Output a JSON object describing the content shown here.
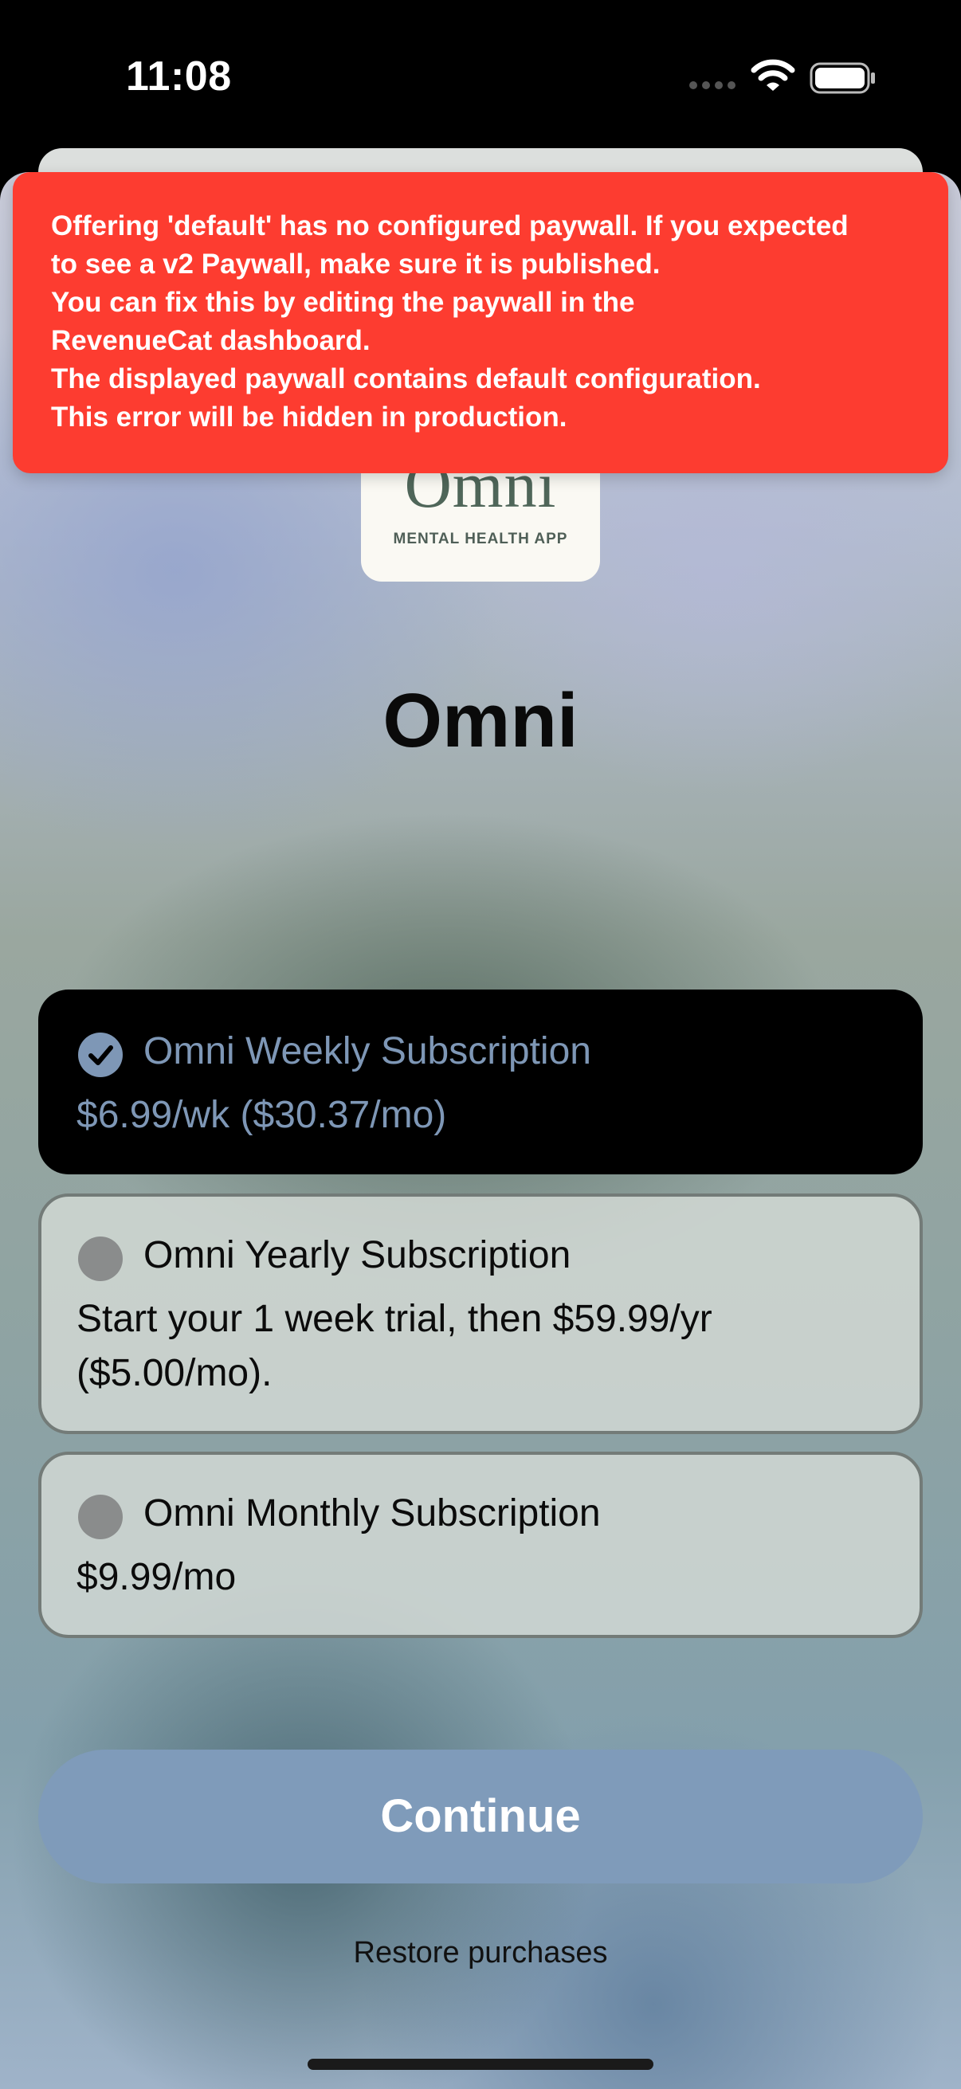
{
  "status_bar": {
    "time": "11:08",
    "icons": [
      "cellular-signal-icon",
      "wifi-icon",
      "battery-icon"
    ]
  },
  "error_banner": {
    "color": "#fd3c30",
    "lines": [
      "Offering 'default' has no configured paywall. If you expected",
      "to see a v2 Paywall, make sure it is published.",
      "You can fix this by editing the paywall in the",
      "RevenueCat dashboard.",
      "The displayed paywall contains default configuration.",
      "This error will be hidden in production."
    ]
  },
  "app_logo": {
    "wordmark": "Omni",
    "tagline": "MENTAL HEALTH APP"
  },
  "title": "Omni",
  "packages": [
    {
      "name": "Omni Weekly Subscription",
      "description": "$6.99/wk ($30.37/mo)",
      "selected": true
    },
    {
      "name": "Omni Yearly Subscription",
      "description": "Start your 1 week trial, then $59.99/yr ($5.00/mo).",
      "selected": false
    },
    {
      "name": "Omni Monthly Subscription",
      "description": "$9.99/mo",
      "selected": false
    }
  ],
  "continue_label": "Continue",
  "restore_label": "Restore purchases",
  "colors": {
    "accent": "#7f9bba",
    "selected_text": "#7e97b6"
  }
}
